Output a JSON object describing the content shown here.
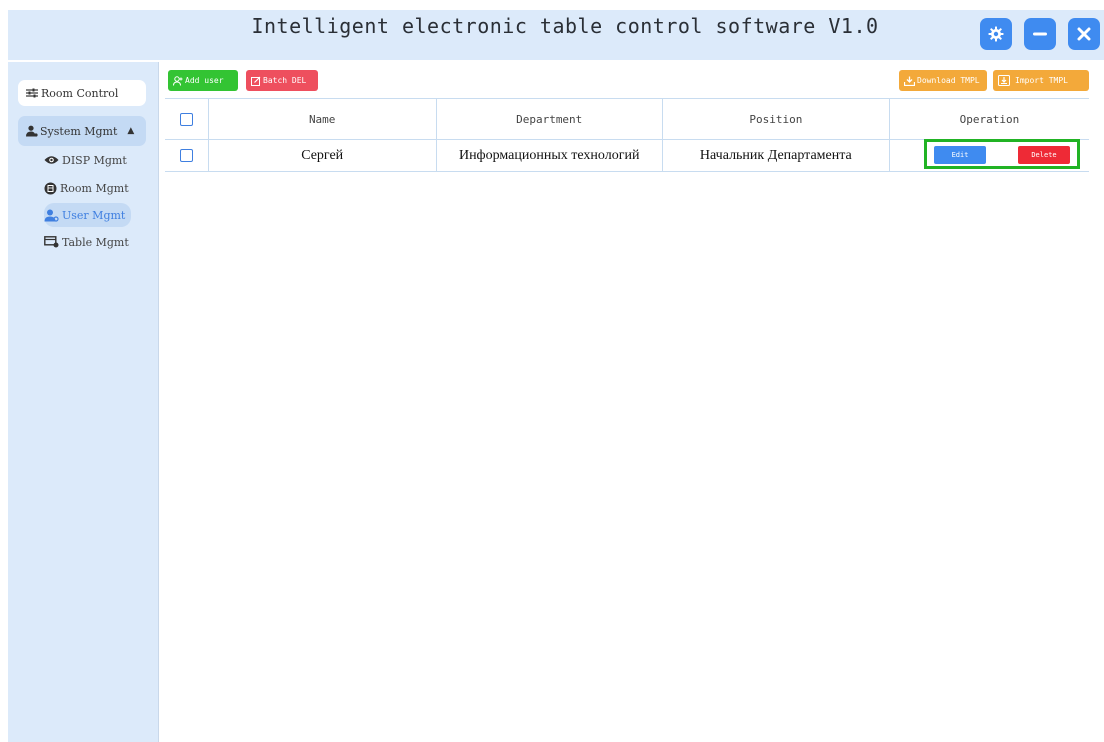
{
  "window": {
    "title": "Intelligent electronic table control software V1.0",
    "settings_icon": "gear-icon",
    "minimize_icon": "minus-icon",
    "close_icon": "close-icon",
    "accent": "#3f8bf0"
  },
  "sidebar": {
    "room_control": "Room Control",
    "system_mgmt": "System Mgmt",
    "system_mgmt_caret": "▲",
    "items": [
      {
        "label": "DISP Mgmt",
        "icon": "eye-icon",
        "active": false
      },
      {
        "label": "Room Mgmt",
        "icon": "room-icon",
        "active": false
      },
      {
        "label": "User Mgmt",
        "icon": "users-icon",
        "active": true
      },
      {
        "label": "Table Mgmt",
        "icon": "table-icon",
        "active": false
      }
    ]
  },
  "toolbar": {
    "add_user": "Add user",
    "batch_del": "Batch DEL",
    "download_tmpl": "Download TMPL",
    "import_tmpl": "Import TMPL",
    "colors": {
      "add": "#33c433",
      "batch": "#ee4f5e",
      "download": "#f3a93a",
      "import": "#f3a93a"
    }
  },
  "table": {
    "columns": [
      "Name",
      "Department",
      "Position",
      "Operation"
    ],
    "rows": [
      {
        "name": "Сергей",
        "department": "Информационных технологий",
        "position": "Начальник Департамента",
        "edit": "Edit",
        "delete": "Delete"
      }
    ]
  }
}
